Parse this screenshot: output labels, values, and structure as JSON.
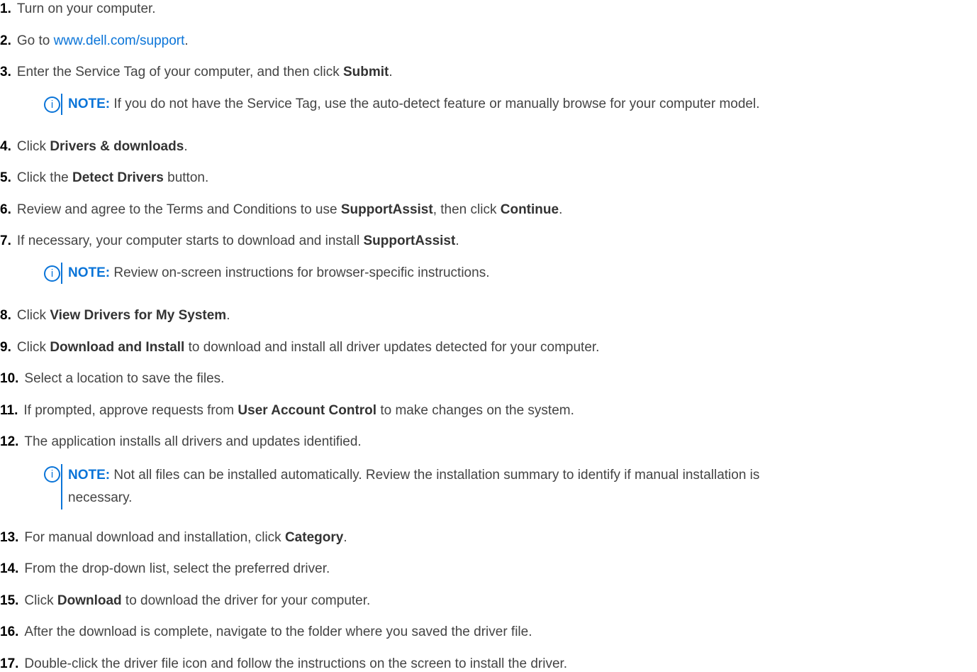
{
  "colors": {
    "text": "#444444",
    "number": "#000000",
    "accent": "#0a74d8"
  },
  "steps": [
    {
      "num": "1.",
      "parts": [
        {
          "t": "Turn on your computer."
        }
      ]
    },
    {
      "num": "2.",
      "parts": [
        {
          "t": "Go to "
        },
        {
          "t": "www.dell.com/support",
          "link": true
        },
        {
          "t": "."
        }
      ]
    },
    {
      "num": "3.",
      "parts": [
        {
          "t": "Enter the Service Tag of your computer, and then click "
        },
        {
          "t": "Submit",
          "b": true
        },
        {
          "t": "."
        }
      ]
    },
    {
      "num": "4.",
      "parts": [
        {
          "t": "Click "
        },
        {
          "t": "Drivers & downloads",
          "b": true
        },
        {
          "t": "."
        }
      ]
    },
    {
      "num": "5.",
      "parts": [
        {
          "t": "Click the "
        },
        {
          "t": "Detect Drivers",
          "b": true
        },
        {
          "t": " button."
        }
      ]
    },
    {
      "num": "6.",
      "parts": [
        {
          "t": "Review and agree to the Terms and Conditions to use "
        },
        {
          "t": "SupportAssist",
          "b": true
        },
        {
          "t": ", then click "
        },
        {
          "t": "Continue",
          "b": true
        },
        {
          "t": "."
        }
      ]
    },
    {
      "num": "7.",
      "parts": [
        {
          "t": "If necessary, your computer starts to download and install "
        },
        {
          "t": "SupportAssist",
          "b": true
        },
        {
          "t": "."
        }
      ]
    },
    {
      "num": "8.",
      "parts": [
        {
          "t": "Click "
        },
        {
          "t": "View Drivers for My System",
          "b": true
        },
        {
          "t": "."
        }
      ]
    },
    {
      "num": "9.",
      "parts": [
        {
          "t": "Click "
        },
        {
          "t": "Download and Install",
          "b": true
        },
        {
          "t": " to download and install all driver updates detected for your computer."
        }
      ]
    },
    {
      "num": "10.",
      "parts": [
        {
          "t": "Select a location to save the files."
        }
      ]
    },
    {
      "num": "11.",
      "parts": [
        {
          "t": "If prompted, approve requests from "
        },
        {
          "t": "User Account Control",
          "b": true
        },
        {
          "t": " to make changes on the system."
        }
      ]
    },
    {
      "num": "12.",
      "parts": [
        {
          "t": "The application installs all drivers and updates identified."
        }
      ]
    },
    {
      "num": "13.",
      "parts": [
        {
          "t": "For manual download and installation, click "
        },
        {
          "t": "Category",
          "b": true
        },
        {
          "t": "."
        }
      ]
    },
    {
      "num": "14.",
      "parts": [
        {
          "t": "From the drop-down list, select the preferred driver."
        }
      ]
    },
    {
      "num": "15.",
      "parts": [
        {
          "t": "Click "
        },
        {
          "t": "Download",
          "b": true
        },
        {
          "t": " to download the driver for your computer."
        }
      ]
    },
    {
      "num": "16.",
      "parts": [
        {
          "t": "After the download is complete, navigate to the folder where you saved the driver file."
        }
      ]
    },
    {
      "num": "17.",
      "parts": [
        {
          "t": "Double-click the driver file icon and follow the instructions on the screen to install the driver."
        }
      ]
    }
  ],
  "notes": {
    "label": "NOTE:",
    "icon_glyph": "i",
    "note1": "If you do not have the Service Tag, use the auto-detect feature or manually browse for your computer model.",
    "note2": "Review on-screen instructions for browser-specific instructions.",
    "note3_line1": "Not all files can be installed automatically. Review the installation summary to identify if manual installation is",
    "note3_line2": "necessary."
  }
}
